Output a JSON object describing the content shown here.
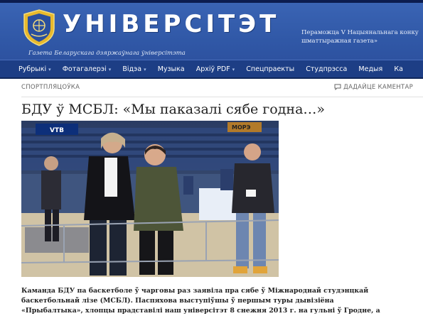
{
  "header": {
    "site_title": "УНІВЕРСІТЭТ",
    "site_subtitle": "Газета Беларускага дзяржаўнага ўніверсітэта",
    "promo_line1": "Пераможца V Нацыянальнага конку",
    "promo_line2": "шматтыражная газета»",
    "emblem_icon": "bsu-crest-icon"
  },
  "nav": {
    "items": [
      {
        "label": "Рубрыкі",
        "dropdown": true
      },
      {
        "label": "Фотагалерэі",
        "dropdown": true
      },
      {
        "label": "Відэа",
        "dropdown": true
      },
      {
        "label": "Музыка",
        "dropdown": false
      },
      {
        "label": "Архіў PDF",
        "dropdown": true
      },
      {
        "label": "Спецпраекты",
        "dropdown": false
      },
      {
        "label": "Студпрэсса",
        "dropdown": false
      },
      {
        "label": "Медыя",
        "dropdown": false
      },
      {
        "label": "Ка",
        "dropdown": false
      }
    ]
  },
  "article": {
    "category": "СПОРТПЛЯЦОЎКА",
    "comment_link": "ДАДАЙЦЕ КАМЕНТАР",
    "comment_icon": "speech-bubble-icon",
    "title": "БДУ ў МСБЛ: «Мы паказалі сябе годна…»",
    "body_line1": "Каманда БДУ па баскетболе ў чарговы раз заявіла пра сябе ў Міжнароднай студэнцкай",
    "body_line2": "баскетбольнай лізе (МСБЛ). Паспяхова выступіўшы ў першым туры дывізіёна",
    "body_line3": "«Прыбалтыка», хлопцы прадставілі наш універсітэт 8 снежня 2013 г. на гульні ў Гродне, а",
    "photo_sign": "VTB",
    "photo_board": "МОРЭ"
  },
  "colors": {
    "banner": "#3159a8",
    "nav": "#1d3e85",
    "top_strip": "#0c1d4f"
  }
}
